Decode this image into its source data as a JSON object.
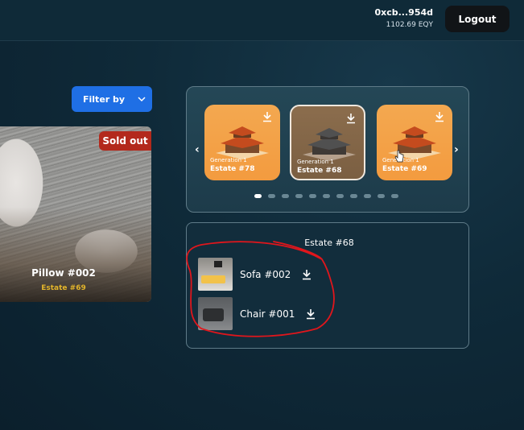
{
  "header": {
    "wallet_address": "0xcb...954d",
    "balance": "1102.69 EQY",
    "logout_label": "Logout"
  },
  "filter": {
    "label": "Filter by",
    "icon": "chevron-down-icon"
  },
  "product_card": {
    "badge": "Sold out",
    "name": "Pillow #002",
    "estate": "Estate #69"
  },
  "carousel": {
    "prev_icon": "chevron-left-icon",
    "next_icon": "chevron-right-icon",
    "cards": [
      {
        "generation": "Generation 1",
        "name": "Estate #78",
        "selected": false
      },
      {
        "generation": "Generation 1",
        "name": "Estate #68",
        "selected": true
      },
      {
        "generation": "Generation 1",
        "name": "Estate #69",
        "selected": false
      }
    ],
    "page_count": 11,
    "active_page": 1
  },
  "items_panel": {
    "title": "Estate #68",
    "items": [
      {
        "name": "Sofa #002",
        "icon": "download-icon"
      },
      {
        "name": "Chair #001",
        "icon": "download-icon"
      }
    ]
  },
  "colors": {
    "accent": "#1f6fe5",
    "sold_out": "#b3291c",
    "estate_label": "#e3b52b",
    "annotation": "#e0161c"
  }
}
